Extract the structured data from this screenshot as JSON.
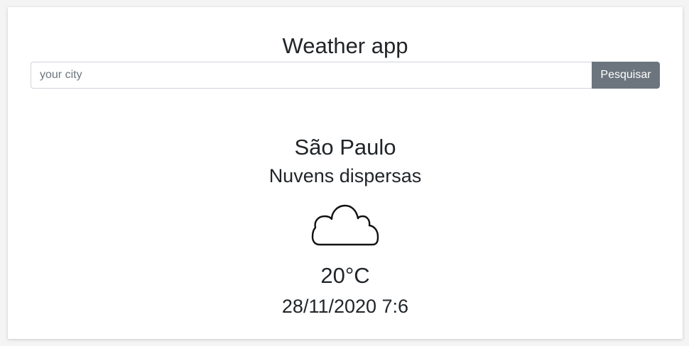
{
  "app": {
    "title": "Weather app"
  },
  "search": {
    "placeholder": "your city",
    "value": "",
    "button_label": "Pesquisar"
  },
  "weather": {
    "city": "São Paulo",
    "description": "Nuvens dispersas",
    "icon": "cloud-icon",
    "temperature": "20°C",
    "datetime": "28/11/2020 7:6"
  },
  "colors": {
    "button_bg": "#6c757d",
    "text": "#212529",
    "card_bg": "#ffffff"
  }
}
